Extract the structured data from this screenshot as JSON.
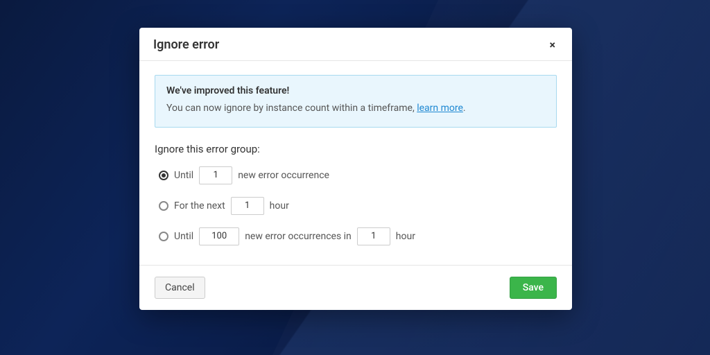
{
  "modal": {
    "title": "Ignore error",
    "close_icon": "×",
    "banner": {
      "title": "We've improved this feature!",
      "text_prefix": "You can now ignore by instance count within a timeframe, ",
      "link_text": "learn more",
      "text_suffix": "."
    },
    "section_label": "Ignore this error group:",
    "options": {
      "opt1": {
        "selected": true,
        "prefix": "Until",
        "value": "1",
        "suffix": "new error occurrence"
      },
      "opt2": {
        "selected": false,
        "prefix": "For the next",
        "value": "1",
        "suffix": "hour"
      },
      "opt3": {
        "selected": false,
        "prefix": "Until",
        "value1": "100",
        "mid": "new error occurrences in",
        "value2": "1",
        "suffix": "hour"
      }
    },
    "footer": {
      "cancel": "Cancel",
      "save": "Save"
    }
  }
}
